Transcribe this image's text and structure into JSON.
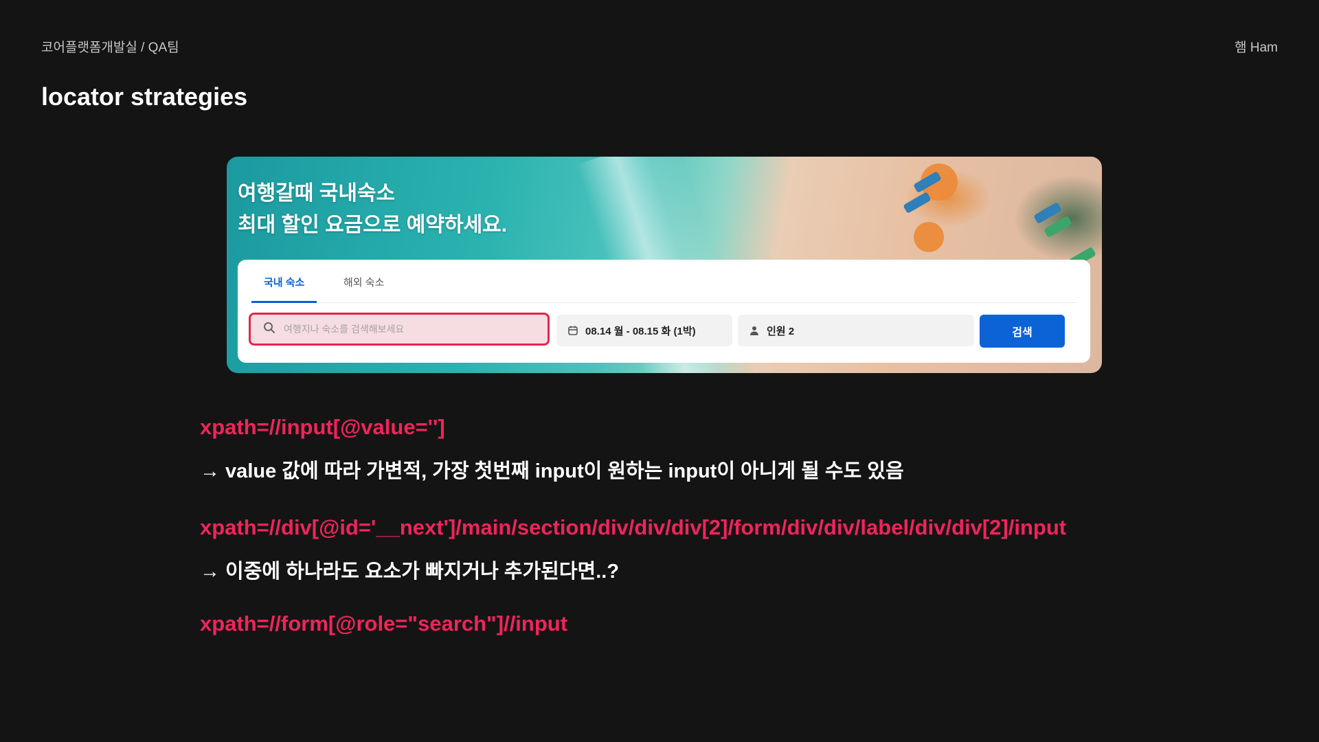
{
  "header": {
    "breadcrumb": "코어플랫폼개발실 / QA팀",
    "author": "햄 Ham"
  },
  "title": "locator strategies",
  "screenshot": {
    "hero_line1": "여행갈때 국내숙소",
    "hero_line2": "최대 할인 요금으로 예약하세요.",
    "tabs": [
      {
        "label": "국내 숙소",
        "active": true
      },
      {
        "label": "해외 숙소",
        "active": false
      }
    ],
    "search_placeholder": "여행지나 숙소를 검색해보세요",
    "date_range": "08.14 월 - 08.15 화 (1박)",
    "guests": "인원 2",
    "search_button": "검색",
    "highlight_color": "#e6244f",
    "button_color": "#0b63d6"
  },
  "locators": [
    {
      "xpath": "xpath=//input[@value='']",
      "note": "→ value 값에 따라 가변적, 가장 첫번째 input이 원하는 input이 아니게 될 수도 있음"
    },
    {
      "xpath": "xpath=//div[@id='__next']/main/section/div/div/div[2]/form/div/div/label/div/div[2]/input",
      "note": "→ 이중에 하나라도 요소가 빠지거나 추가된다면..?"
    },
    {
      "xpath": "xpath=//form[@role=\"search\"]//input",
      "note": ""
    }
  ],
  "accent_color": "#f0255a"
}
